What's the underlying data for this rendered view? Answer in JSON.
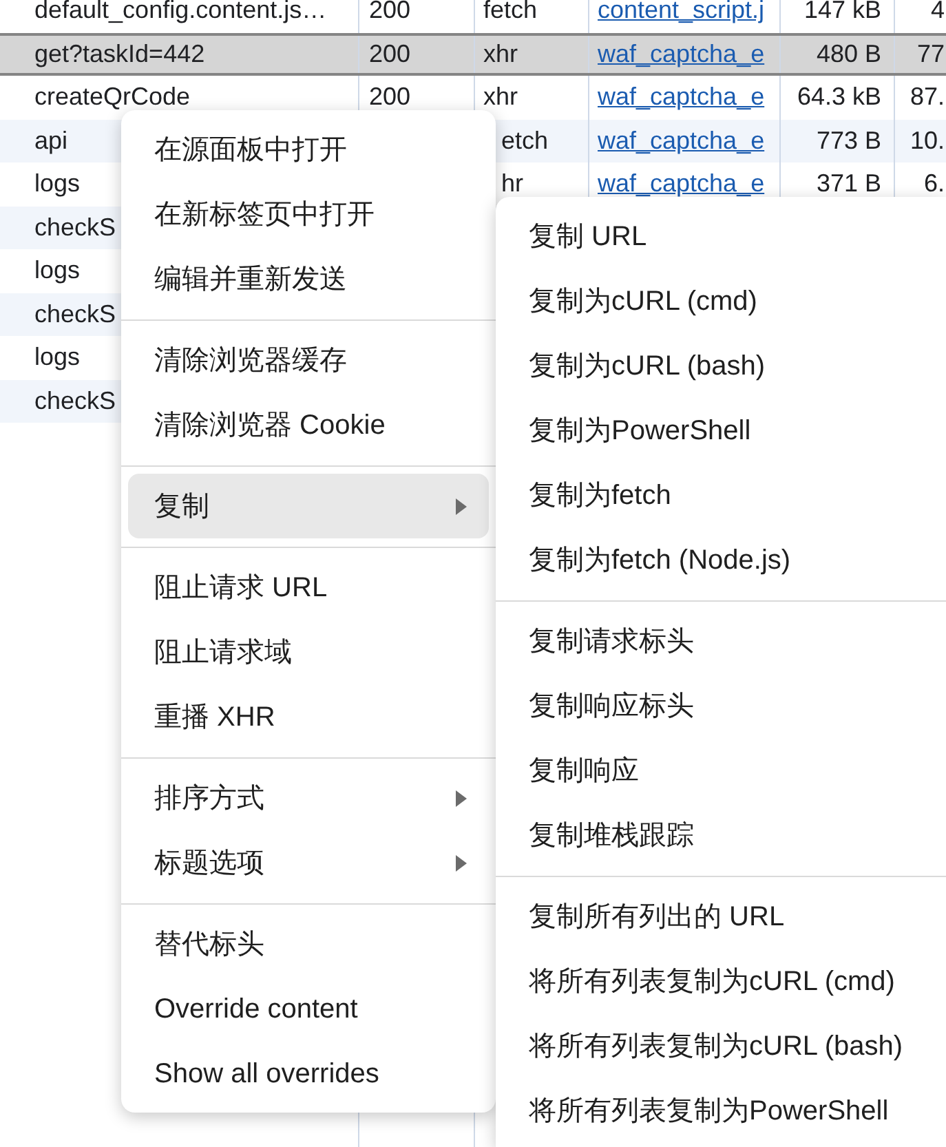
{
  "network_table": {
    "rows": [
      {
        "name": "default_config.content.js…",
        "status": "200",
        "type": "fetch",
        "initiator": "content_script.j",
        "size": "147 kB",
        "time": "4",
        "selected": false
      },
      {
        "name": "get?taskId=442",
        "status": "200",
        "type": "xhr",
        "initiator": "waf_captcha_e",
        "size": "480 B",
        "time": "77",
        "selected": true
      },
      {
        "name": "createQrCode",
        "status": "200",
        "type": "xhr",
        "initiator": "waf_captcha_e",
        "size": "64.3 kB",
        "time": "87.",
        "selected": false
      },
      {
        "name": "api",
        "type": "etch",
        "initiator": "waf_captcha_e",
        "size": "773 B",
        "time": "10.",
        "selected": false
      },
      {
        "name": "logs",
        "type": "hr",
        "initiator": "waf_captcha_e",
        "size": "371 B",
        "time": "6.",
        "selected": false
      },
      {
        "name": "checkS",
        "selected": false
      },
      {
        "name": "logs",
        "selected": false
      },
      {
        "name": "checkS",
        "selected": false
      },
      {
        "name": "logs",
        "selected": false
      },
      {
        "name": "checkS",
        "selected": false
      }
    ]
  },
  "context_menu": {
    "groups": [
      {
        "items": [
          {
            "label": "在源面板中打开",
            "selected": false,
            "has_submenu": false
          },
          {
            "label": "在新标签页中打开",
            "selected": false,
            "has_submenu": false
          },
          {
            "label": "编辑并重新发送",
            "selected": false,
            "has_submenu": false
          }
        ]
      },
      {
        "items": [
          {
            "label": "清除浏览器缓存",
            "selected": false,
            "has_submenu": false
          },
          {
            "label": "清除浏览器 Cookie",
            "selected": false,
            "has_submenu": false
          }
        ]
      },
      {
        "items": [
          {
            "label": "复制",
            "selected": true,
            "has_submenu": true
          }
        ]
      },
      {
        "items": [
          {
            "label": "阻止请求 URL",
            "selected": false,
            "has_submenu": false
          },
          {
            "label": "阻止请求域",
            "selected": false,
            "has_submenu": false
          },
          {
            "label": "重播 XHR",
            "selected": false,
            "has_submenu": false
          }
        ]
      },
      {
        "items": [
          {
            "label": "排序方式",
            "selected": false,
            "has_submenu": true
          },
          {
            "label": "标题选项",
            "selected": false,
            "has_submenu": true
          }
        ]
      },
      {
        "items": [
          {
            "label": "替代标头",
            "selected": false,
            "has_submenu": false
          },
          {
            "label": "Override content",
            "selected": false,
            "has_submenu": false
          },
          {
            "label": "Show all overrides",
            "selected": false,
            "has_submenu": false
          }
        ]
      }
    ]
  },
  "copy_submenu": {
    "groups": [
      {
        "items": [
          {
            "label": "复制 URL",
            "selected": false
          },
          {
            "label": "复制为cURL (cmd)",
            "selected": false
          },
          {
            "label": "复制为cURL (bash)",
            "selected": false
          },
          {
            "label": "复制为PowerShell",
            "selected": false
          },
          {
            "label": "复制为fetch",
            "selected": false
          },
          {
            "label": "复制为fetch (Node.js)",
            "selected": false
          }
        ]
      },
      {
        "items": [
          {
            "label": "复制请求标头",
            "selected": false
          },
          {
            "label": "复制响应标头",
            "selected": false
          },
          {
            "label": "复制响应",
            "selected": false
          },
          {
            "label": "复制堆栈跟踪",
            "selected": false
          }
        ]
      },
      {
        "items": [
          {
            "label": "复制所有列出的 URL",
            "selected": false
          },
          {
            "label": "将所有列表复制为cURL (cmd)",
            "selected": false
          },
          {
            "label": "将所有列表复制为cURL (bash)",
            "selected": false
          },
          {
            "label": "将所有列表复制为PowerShell",
            "selected": false
          }
        ]
      }
    ]
  }
}
